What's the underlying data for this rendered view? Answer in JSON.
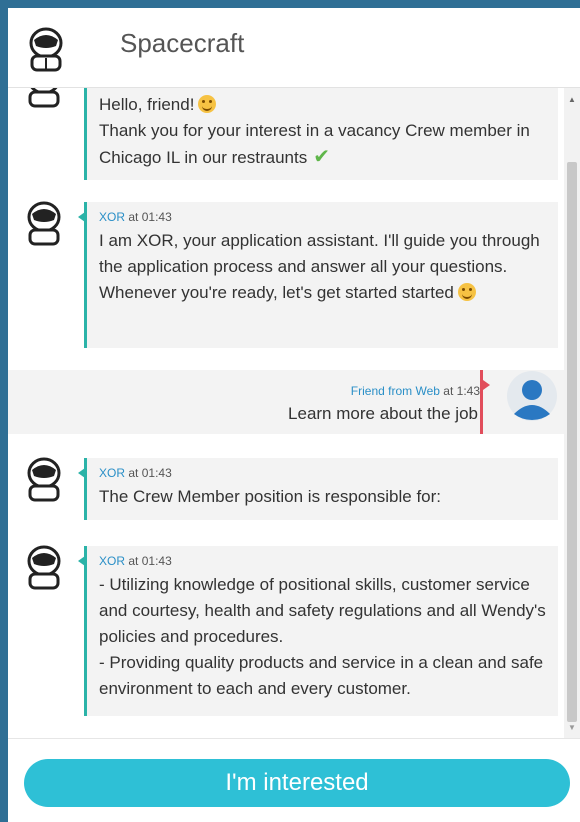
{
  "header": {
    "title": "Spacecraft",
    "logo_icon": "astronaut-icon"
  },
  "messages": [
    {
      "author": "",
      "time": "",
      "text": "Hello, friend!",
      "icon": "smile-emoji-icon",
      "text2": "Thank you for your interest in a vacancy Crew member in Chicago IL in our restraunts",
      "check_icon": "check-icon"
    },
    {
      "author": "XOR",
      "at": "at",
      "time": "01:43",
      "text": "I am XOR, your application assistant. I'll guide you through the application process and answer all your questions.\nWhenever you're ready, let's get started started",
      "icon": "wink-emoji-icon"
    },
    {
      "author": "Friend from Web",
      "at": "at",
      "time": "1:43",
      "text": "Learn more about the job"
    },
    {
      "author": "XOR",
      "at": "at",
      "time": "01:43",
      "text": "The Crew Member position is responsible for:"
    },
    {
      "author": "XOR",
      "at": "at",
      "time": "01:43",
      "text": "- Utilizing knowledge of positional skills, customer service and courtesy, health and safety regulations and all Wendy's policies and procedures.\n- Providing quality products and service in a clean and safe environment to each and every customer."
    }
  ],
  "footer": {
    "button_label": "I'm interested"
  },
  "colors": {
    "accent": "#2ec0d6",
    "bot_bar": "#2bb3a8",
    "user_bar": "#e14d5b",
    "frame": "#2f6f95"
  }
}
